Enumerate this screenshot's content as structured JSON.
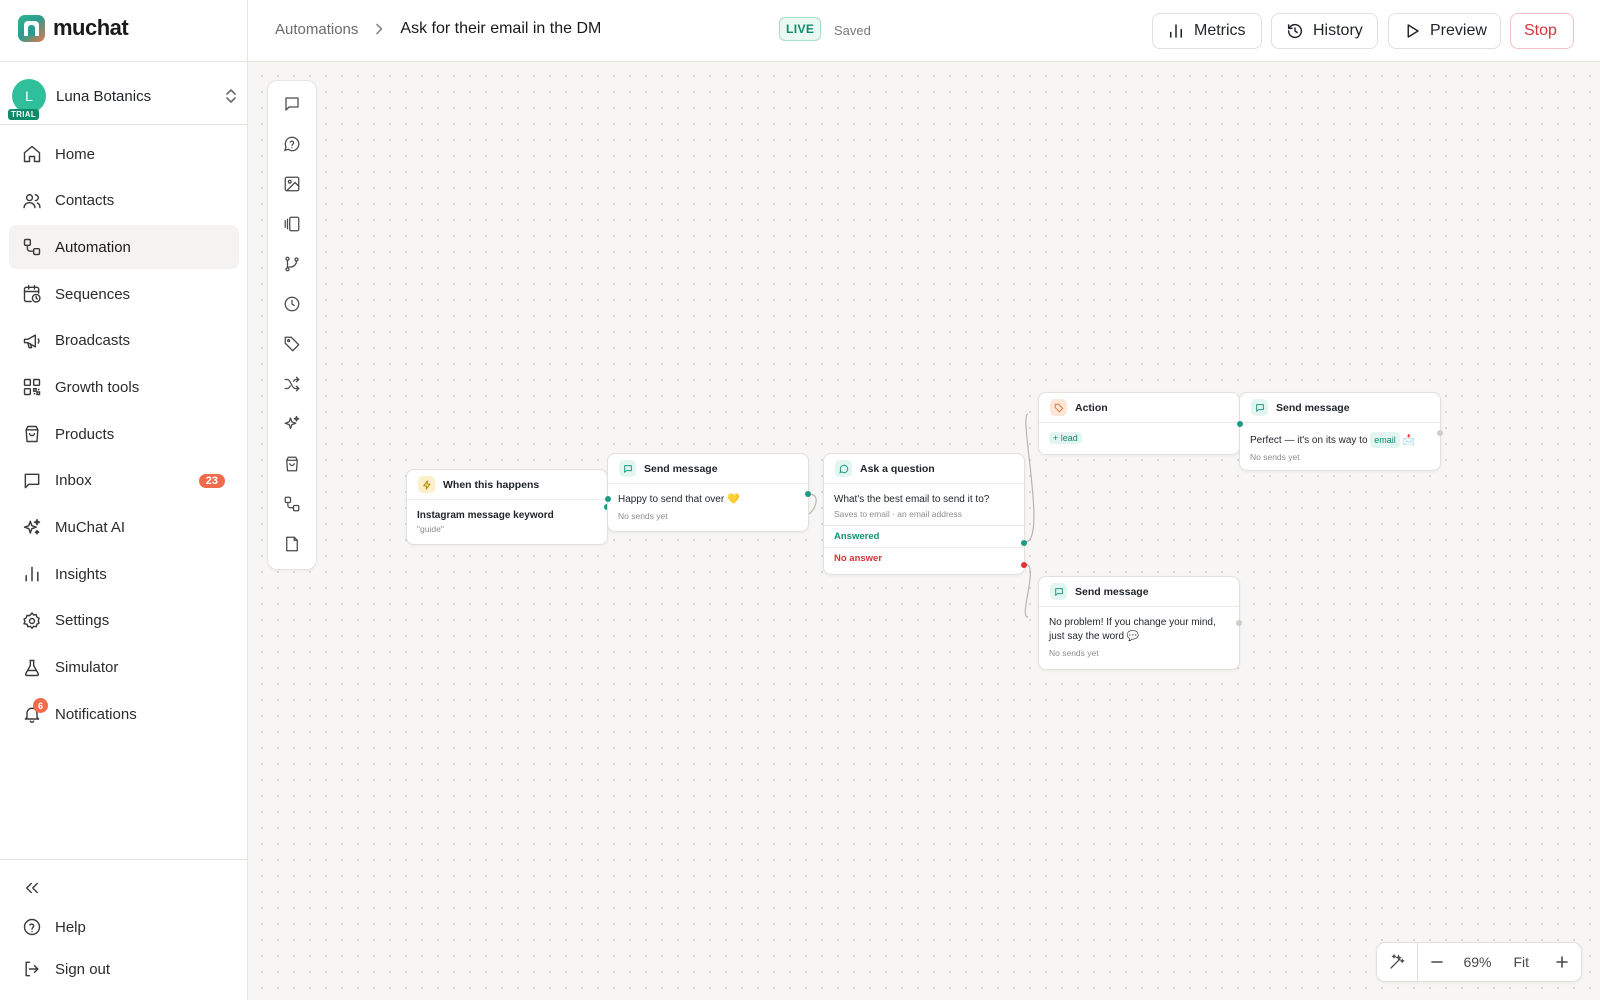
{
  "app": {
    "name": "muchat"
  },
  "workspace": {
    "name": "Luna Botanics",
    "initial": "L",
    "badge": "TRIAL"
  },
  "sidebar": {
    "items": [
      {
        "label": "Home",
        "icon": "home-icon"
      },
      {
        "label": "Contacts",
        "icon": "users-icon"
      },
      {
        "label": "Automation",
        "icon": "automation-icon",
        "active": true
      },
      {
        "label": "Sequences",
        "icon": "calendar-clock-icon"
      },
      {
        "label": "Broadcasts",
        "icon": "megaphone-icon"
      },
      {
        "label": "Growth tools",
        "icon": "qr-code-icon"
      },
      {
        "label": "Products",
        "icon": "shopping-bag-icon"
      },
      {
        "label": "Inbox",
        "icon": "message-square-icon",
        "badge": "23"
      },
      {
        "label": "MuChat AI",
        "icon": "sparkles-icon"
      },
      {
        "label": "Insights",
        "icon": "bar-chart-icon"
      },
      {
        "label": "Settings",
        "icon": "gear-icon"
      },
      {
        "label": "Simulator",
        "icon": "flask-icon"
      },
      {
        "label": "Notifications",
        "icon": "bell-icon",
        "badge": "6"
      }
    ],
    "bottom": [
      {
        "label": "Help",
        "icon": "help-circle-icon"
      },
      {
        "label": "Sign out",
        "icon": "sign-out-icon"
      }
    ]
  },
  "header": {
    "breadcrumb_root": "Automations",
    "title": "Ask for their email in the DM",
    "status": "LIVE",
    "save_state": "Saved",
    "buttons": {
      "metrics": "Metrics",
      "history": "History",
      "preview": "Preview",
      "stop": "Stop"
    }
  },
  "canvas": {
    "toolbox": [
      "message-icon",
      "question-icon",
      "image-icon",
      "carousel-icon",
      "branch-icon",
      "clock-icon",
      "tag-icon",
      "shuffle-icon",
      "sparkles-icon",
      "shopping-bag-icon",
      "automation-icon",
      "file-icon"
    ],
    "nodes": {
      "trigger": {
        "title": "When this happens",
        "text": "Instagram message keyword",
        "sub": "\"guide\""
      },
      "send1": {
        "title": "Send message",
        "text": "Happy to send that over 💛",
        "sub": "No sends yet"
      },
      "question": {
        "title": "Ask a question",
        "text": "What's the best email to send it to?",
        "sub": "Saves to email · an email address",
        "answered": "Answered",
        "no_answer": "No answer"
      },
      "action": {
        "title": "Action",
        "tag": "+ lead"
      },
      "send2": {
        "title": "Send message",
        "text": "Perfect — it's on its way to",
        "var": "email",
        "emoji": "📩",
        "sub": "No sends yet"
      },
      "send3": {
        "title": "Send message",
        "text": "No problem! If you change your mind, just say the word 💬",
        "sub": "No sends yet"
      }
    },
    "zoom": "69%",
    "fit_label": "Fit"
  },
  "colors": {
    "accent": "#0f8b6c",
    "danger": "#d6343a",
    "badge": "#ef6b4a"
  }
}
